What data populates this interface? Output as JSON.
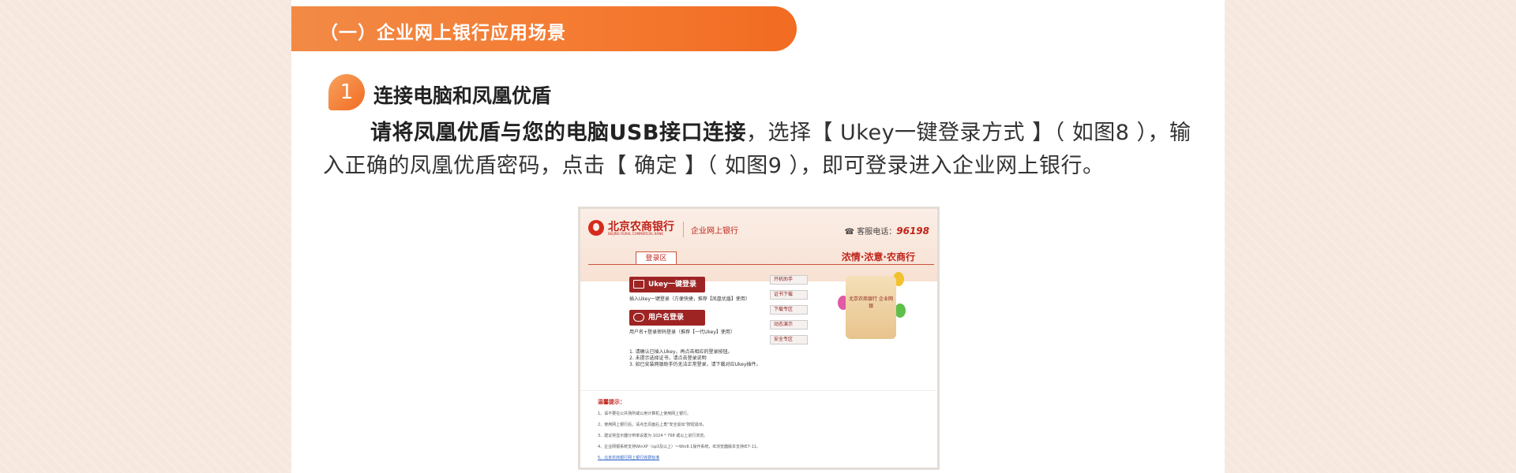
{
  "section": {
    "title": "（一）企业网上银行应用场景"
  },
  "step": {
    "number": "1",
    "title": "连接电脑和凤凰优盾"
  },
  "paragraph": {
    "bold": "请将凤凰优盾与您的电脑USB接口连接",
    "text": "，选择【 Ukey一键登录方式 】（ 如图8 ），输入正确的凤凰优盾密码，点击【 确定 】（ 如图9 ），即可登录进入企业网上银行。"
  },
  "screenshot": {
    "bank_name": "北京农商银行",
    "bank_name_en": "BEIJING RURAL COMMERCIAL BANK",
    "portal_name": "企业网上银行",
    "phone_label": "客服电话：",
    "phone_number": "96198",
    "slogan": "浓情·浓意·农商行",
    "tab_label": "登录区",
    "ukey_login": {
      "label": "Ukey一键登录",
      "desc": "插入Ukey一键登录（方便快捷，推荐【凤凰优盾】使用）"
    },
    "user_login": {
      "label": "用户名登录",
      "desc": "用户名+登录密码登录（推荐【一代Ukey】使用）"
    },
    "help_items": [
      "开机助手",
      "证书下载",
      "下载专区",
      "动态演示",
      "安全专区"
    ],
    "promo_text": "北京农商银行 企业网银",
    "notes": [
      "1. 请确认已插入Ukey，再点击相应的登录按钮。",
      "2. 未提示选择证书，请点击登录说明",
      "3. 如已安装网银助手仍无法正常登录，请下载对应Ukey插件。"
    ],
    "tips_title": "温馨提示：",
    "tips": [
      "1、请不要在公共场所或公用计算机上使用网上银行。",
      "2、使用网上银行后，请点击页面右上角\"安全退出\"按钮退出。",
      "3、建议将显示器分辨率设置为 1024 * 768 或以上进行浏览。",
      "4、企业网银系统支持WinXP（sp3及以上）～Win8.1操作系统，IE浏览器版本支持IE7-11。",
      "5、北京农商银行网上银行收费标准"
    ]
  }
}
